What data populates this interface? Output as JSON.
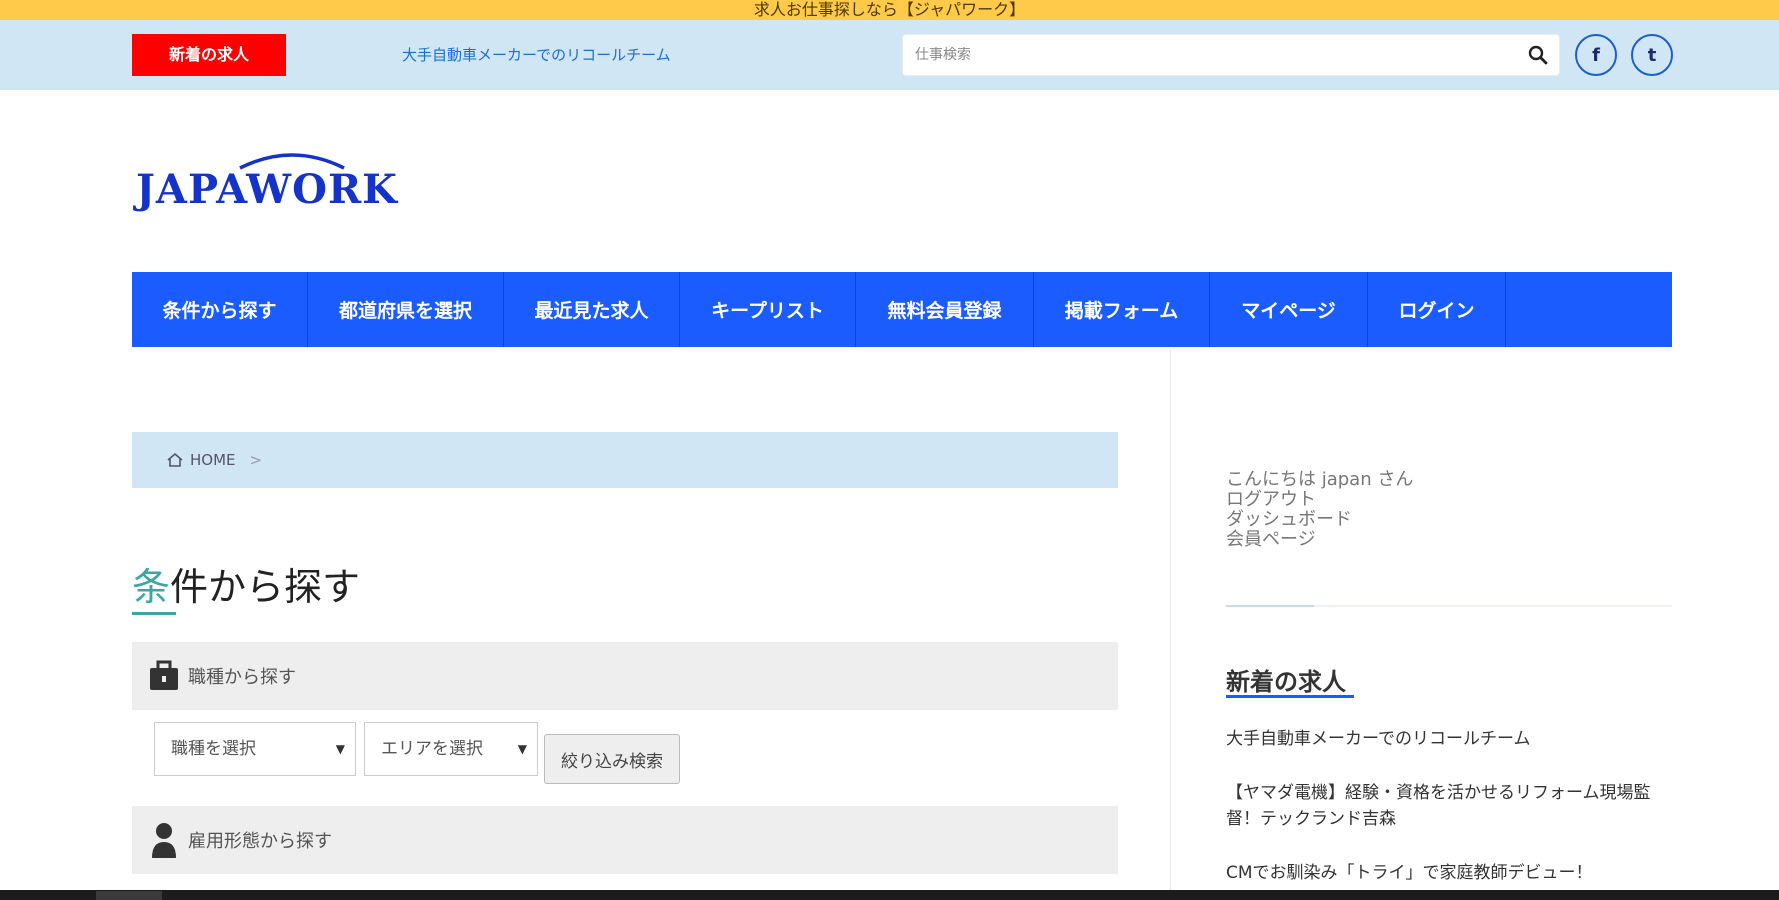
{
  "top_banner": {
    "text": "求人お仕事探しなら【ジャパワーク】"
  },
  "header": {
    "new_badge": "新着の求人",
    "ticker": "大手自動車メーカーでのリコールチーム",
    "search": {
      "placeholder": "仕事検索",
      "value": ""
    },
    "social": {
      "facebook": "f",
      "twitter": "t"
    }
  },
  "logo": {
    "text": "JAPAWORK"
  },
  "nav": {
    "items": [
      {
        "label": "条件から探す"
      },
      {
        "label": "都道府県を選択"
      },
      {
        "label": "最近見た求人"
      },
      {
        "label": "キープリスト"
      },
      {
        "label": "無料会員登録"
      },
      {
        "label": "掲載フォーム"
      },
      {
        "label": "マイページ"
      },
      {
        "label": "ログイン"
      }
    ]
  },
  "breadcrumb": {
    "home": "HOME",
    "separator": ">"
  },
  "main": {
    "title_first": "条",
    "title_rest": "件から探す",
    "filters": {
      "job_type_heading": "職種から探す",
      "job_select": "職種を選択",
      "area_select": "エリアを選択",
      "submit": "絞り込み検索",
      "employment_heading": "雇用形態から探す"
    }
  },
  "sidebar": {
    "greeting": "こんにちは japan さん",
    "links": [
      "ログアウト",
      "ダッシュボード",
      "会員ページ"
    ],
    "new_jobs_title": "新着の求人",
    "jobs": [
      "大手自動車メーカーでのリコールチーム",
      "【ヤマダ電機】経験・資格を活かせるリフォーム現場監督！テックランド吉森",
      "CMでお馴染み「トライ」で家庭教師デビュー！"
    ]
  },
  "colors": {
    "top_banner": "#ffc94a",
    "header_bg": "#d0e6f4",
    "badge_red": "#ff0000",
    "nav_blue": "#1a5cff",
    "title_accent": "#3aa6a6"
  }
}
